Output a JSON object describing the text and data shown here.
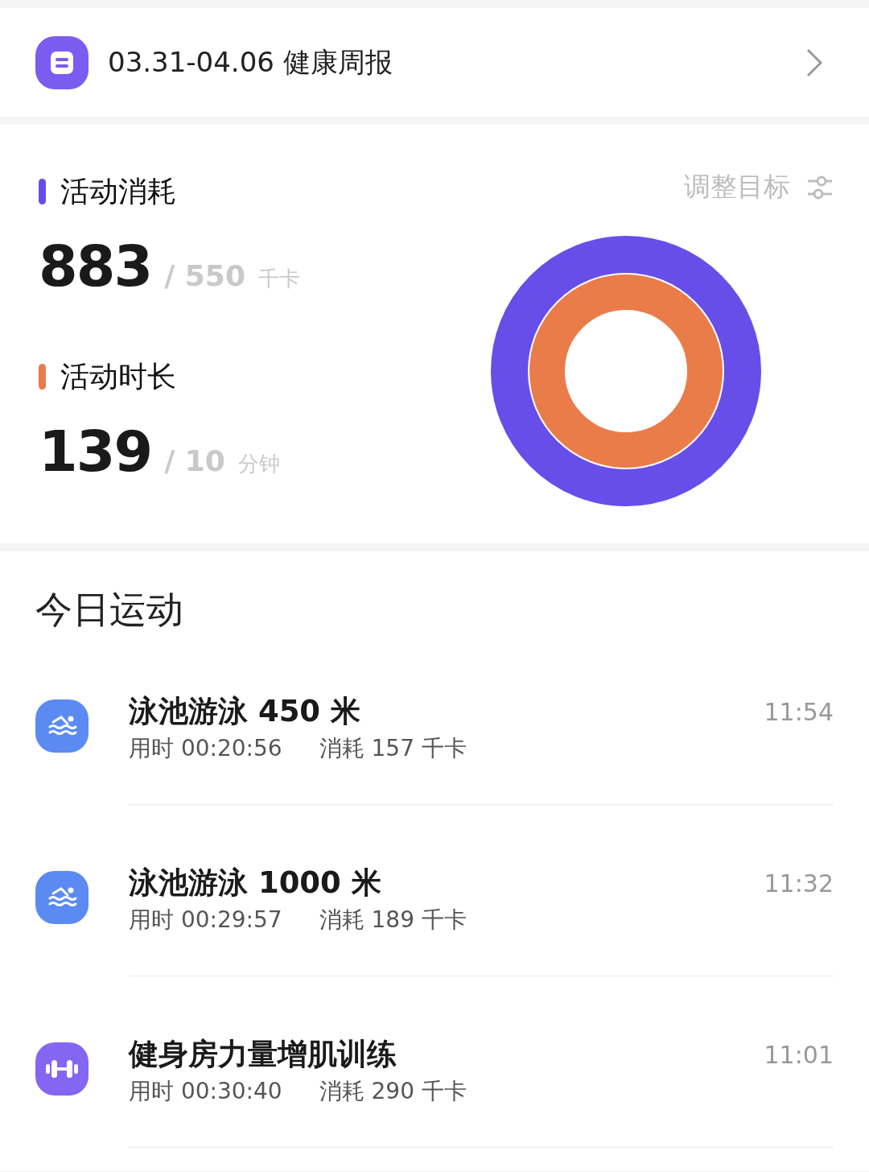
{
  "report": {
    "title": "03.31-04.06 健康周报"
  },
  "summary": {
    "adjust_label": "调整目标",
    "metrics": [
      {
        "label": "活动消耗",
        "value": "883",
        "goal": "/ 550",
        "unit": "千卡",
        "color": "#684ee8",
        "level": 1
      },
      {
        "label": "活动时长",
        "value": "139",
        "goal": "/ 10",
        "unit": "分钟",
        "color": "#ea7c4a",
        "level": 1
      }
    ]
  },
  "today": {
    "title": "今日运动",
    "activities": [
      {
        "kind": "swim",
        "name": "泳池游泳 450 米",
        "duration": "用时 00:20:56",
        "calories": "消耗 157 千卡",
        "time": "11:54"
      },
      {
        "kind": "swim",
        "name": "泳池游泳 1000 米",
        "duration": "用时 00:29:57",
        "calories": "消耗 189 千卡",
        "time": "11:32"
      },
      {
        "kind": "gym",
        "name": "健身房力量增肌训练",
        "duration": "用时 00:30:40",
        "calories": "消耗 290 千卡",
        "time": "11:01"
      }
    ]
  }
}
